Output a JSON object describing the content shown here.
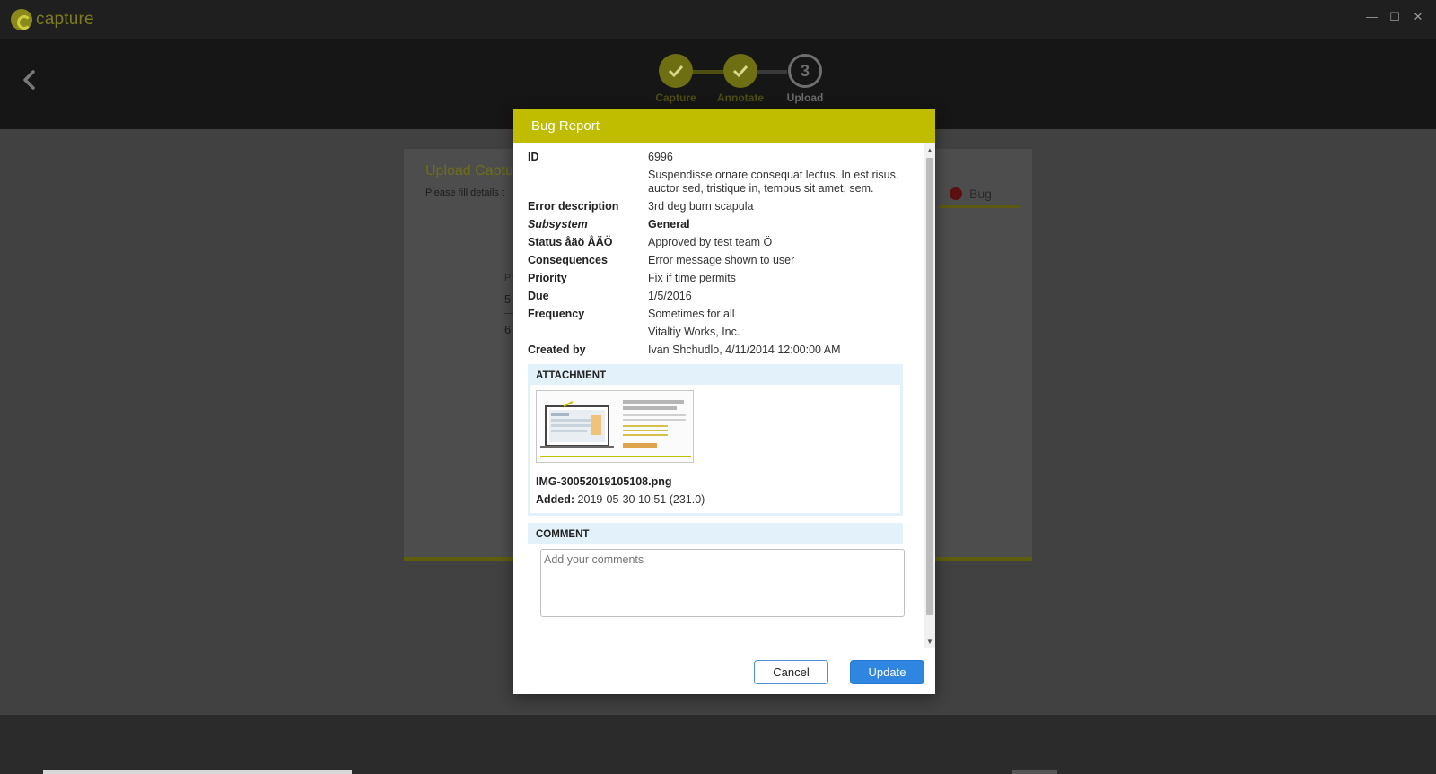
{
  "app": {
    "name": "capture"
  },
  "window_controls": {
    "minimize": "—",
    "maximize": "☐",
    "close": "✕"
  },
  "stepper": {
    "steps": [
      {
        "label": "Capture",
        "state": "done"
      },
      {
        "label": "Annotate",
        "state": "done"
      },
      {
        "label": "Upload",
        "state": "current",
        "number": "3"
      }
    ]
  },
  "background_card": {
    "title": "Upload Captu",
    "subtitle": "Please fill details t",
    "tab_label": "Bug",
    "field_prefix_1": "Pr",
    "field_value_1": "5",
    "field_value_2": "6"
  },
  "modal": {
    "title": "Bug Report",
    "fields": [
      {
        "label": "ID",
        "value": "6996"
      },
      {
        "label": "",
        "value": "Suspendisse ornare consequat lectus. In est risus, auctor sed, tristique in, tempus sit amet, sem."
      },
      {
        "label": "Error description",
        "value": "3rd deg burn scapula"
      },
      {
        "label": "Subsystem",
        "value": "General"
      },
      {
        "label": "Status åäö ÅÄÖ",
        "value": "Approved by test team Ö"
      },
      {
        "label": "Consequences",
        "value": "Error message shown to user"
      },
      {
        "label": "Priority",
        "value": "Fix if time permits"
      },
      {
        "label": "Due",
        "value": "1/5/2016"
      },
      {
        "label": "Frequency",
        "value": "Sometimes for all"
      },
      {
        "label": "",
        "value": "Vitaltiy Works, Inc."
      },
      {
        "label": "Created by",
        "value": "Ivan Shchudlo, 4/11/2014 12:00:00 AM"
      }
    ],
    "attachment": {
      "section_label": "ATTACHMENT",
      "filename": "IMG-30052019105108.png",
      "added_label": "Added:",
      "added_value": "2019-05-30 10:51 (231.0)"
    },
    "comment": {
      "section_label": "COMMENT",
      "placeholder": "Add your comments",
      "value": ""
    },
    "buttons": {
      "cancel": "Cancel",
      "update": "Update"
    }
  },
  "colors": {
    "accent": "#c0bd00",
    "primary_button": "#2e86e0",
    "section_bg": "#e3f1fb"
  }
}
